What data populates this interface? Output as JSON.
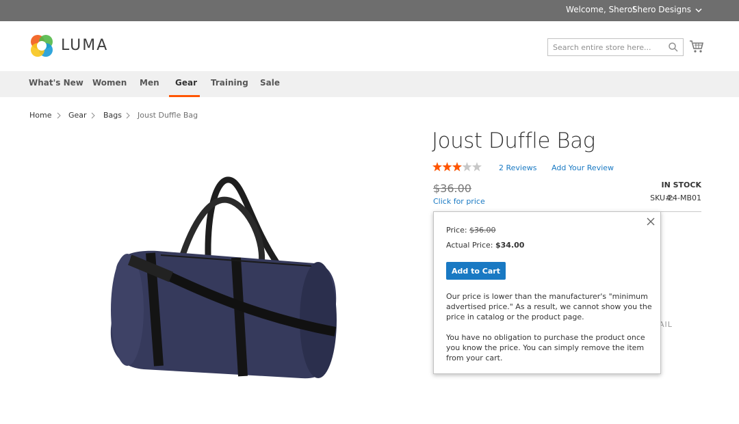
{
  "topbar": {
    "welcome": "Welcome, Shero!",
    "account": "Shero Designs"
  },
  "header": {
    "logo_text": "LUMA",
    "search_placeholder": "Search entire store here..."
  },
  "nav": {
    "items": [
      {
        "label": "What's New"
      },
      {
        "label": "Women"
      },
      {
        "label": "Men"
      },
      {
        "label": "Gear"
      },
      {
        "label": "Training"
      },
      {
        "label": "Sale"
      }
    ],
    "active": "Gear"
  },
  "breadcrumb": [
    "Home",
    "Gear",
    "Bags",
    "Joust Duffle Bag"
  ],
  "product": {
    "title": "Joust Duffle Bag",
    "rating_stars": 2.5,
    "rating_max": 5,
    "reviews": "2 Reviews",
    "add_review": "Add Your Review",
    "old_price": "$36.00",
    "click_for_price": "Click for price",
    "stock": "IN STOCK",
    "sku_label": "SKU#:",
    "sku": "24-MB01",
    "hidden_text": "AIL"
  },
  "popup": {
    "price_label": "Price:",
    "price": "$36.00",
    "actual_label": "Actual Price:",
    "actual_price": "$34.00",
    "add_to_cart": "Add to Cart",
    "message1": "Our price is lower than the manufacturer's \"minimum advertised price.\" As a result, we cannot show you the price in catalog or the product page.",
    "message2": "You have no obligation to purchase the product once you know the price. You can simply remove the item from your cart."
  },
  "colors": {
    "accent": "#1979c3",
    "nav_underline": "#ff5501",
    "star": "#ff5501",
    "topbar": "#6e6e6e"
  }
}
